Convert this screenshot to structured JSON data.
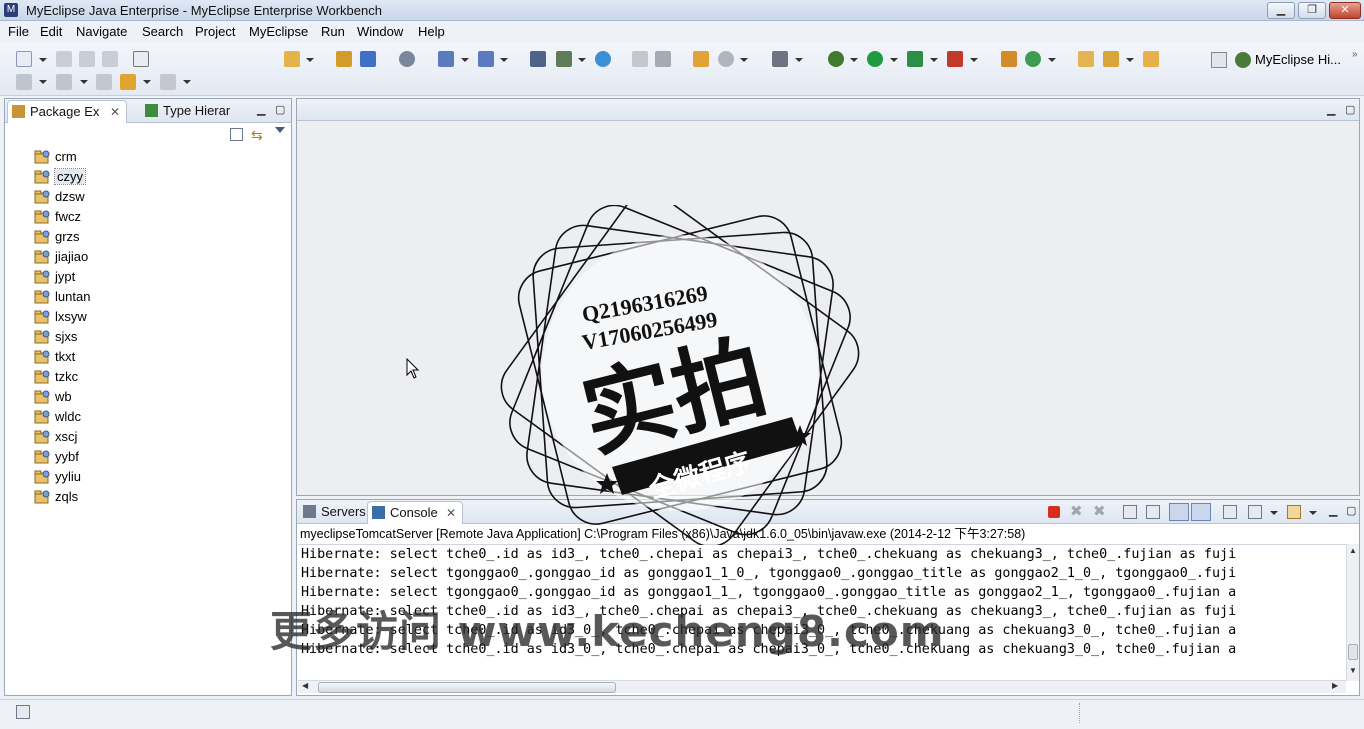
{
  "window": {
    "title": "MyEclipse Java Enterprise - MyEclipse Enterprise Workbench",
    "minimize_icon": "minimize-icon",
    "restore_icon": "restore-icon",
    "close_icon": "close-icon"
  },
  "menu": {
    "items": [
      "File",
      "Edit",
      "Navigate",
      "Search",
      "Project",
      "MyEclipse",
      "Run",
      "Window",
      "Help"
    ]
  },
  "toolbar": {
    "perspective_label": "MyEclipse Hi..."
  },
  "package_explorer": {
    "tabs": [
      {
        "label": "Package Ex",
        "icon": "package-explorer-icon",
        "active": true
      },
      {
        "label": "Type Hierar",
        "icon": "type-hierarchy-icon",
        "active": false
      }
    ],
    "projects": [
      "crm",
      "czyy",
      "dzsw",
      "fwcz",
      "grzs",
      "jiajiao",
      "jypt",
      "luntan",
      "lxsyw",
      "sjxs",
      "tkxt",
      "tzkc",
      "wb",
      "wldc",
      "xscj",
      "yybf",
      "yyliu",
      "zqls"
    ],
    "selected_project": "czyy"
  },
  "console": {
    "tabs": [
      {
        "label": "Servers",
        "icon": "servers-icon",
        "active": false
      },
      {
        "label": "Console",
        "icon": "console-icon",
        "active": true
      }
    ],
    "header": "myeclipseTomcatServer [Remote Java Application] C:\\Program Files (x86)\\Java\\jdk1.6.0_05\\bin\\javaw.exe (2014-2-12 下午3:27:58)",
    "lines": [
      "Hibernate: select tche0_.id as id3_, tche0_.chepai as chepai3_, tche0_.chekuang as chekuang3_, tche0_.fujian as fuji",
      "Hibernate: select tgonggao0_.gonggao_id as gonggao1_1_0_, tgonggao0_.gonggao_title as gonggao2_1_0_, tgonggao0_.fuji",
      "Hibernate: select tgonggao0_.gonggao_id as gonggao1_1_, tgonggao0_.gonggao_title as gonggao2_1_, tgonggao0_.fujian a",
      "Hibernate: select tche0_.id as id3_, tche0_.chepai as chepai3_, tche0_.chekuang as chekuang3_, tche0_.fujian as fuji",
      "Hibernate: select tche0_.id as id3_0_, tche0_.chepai as chepai3_0_, tche0_.chekuang as chekuang3_0_, tche0_.fujian a",
      "Hibernate: select tche0_.id as id3_0_, tche0_.chepai as chepai3_0_, tche0_.chekuang as chekuang3_0_, tche0_.fujian a"
    ]
  },
  "watermark": {
    "stamp_q": "Q2196316269",
    "stamp_v": "V17060256499",
    "stamp_main": "实拍",
    "stamp_banner": "全微程序",
    "site_text": "更多访问 www.kecheng8.com"
  },
  "colors": {
    "accent": "#2c5aa0",
    "stop_red": "#d62d20"
  }
}
